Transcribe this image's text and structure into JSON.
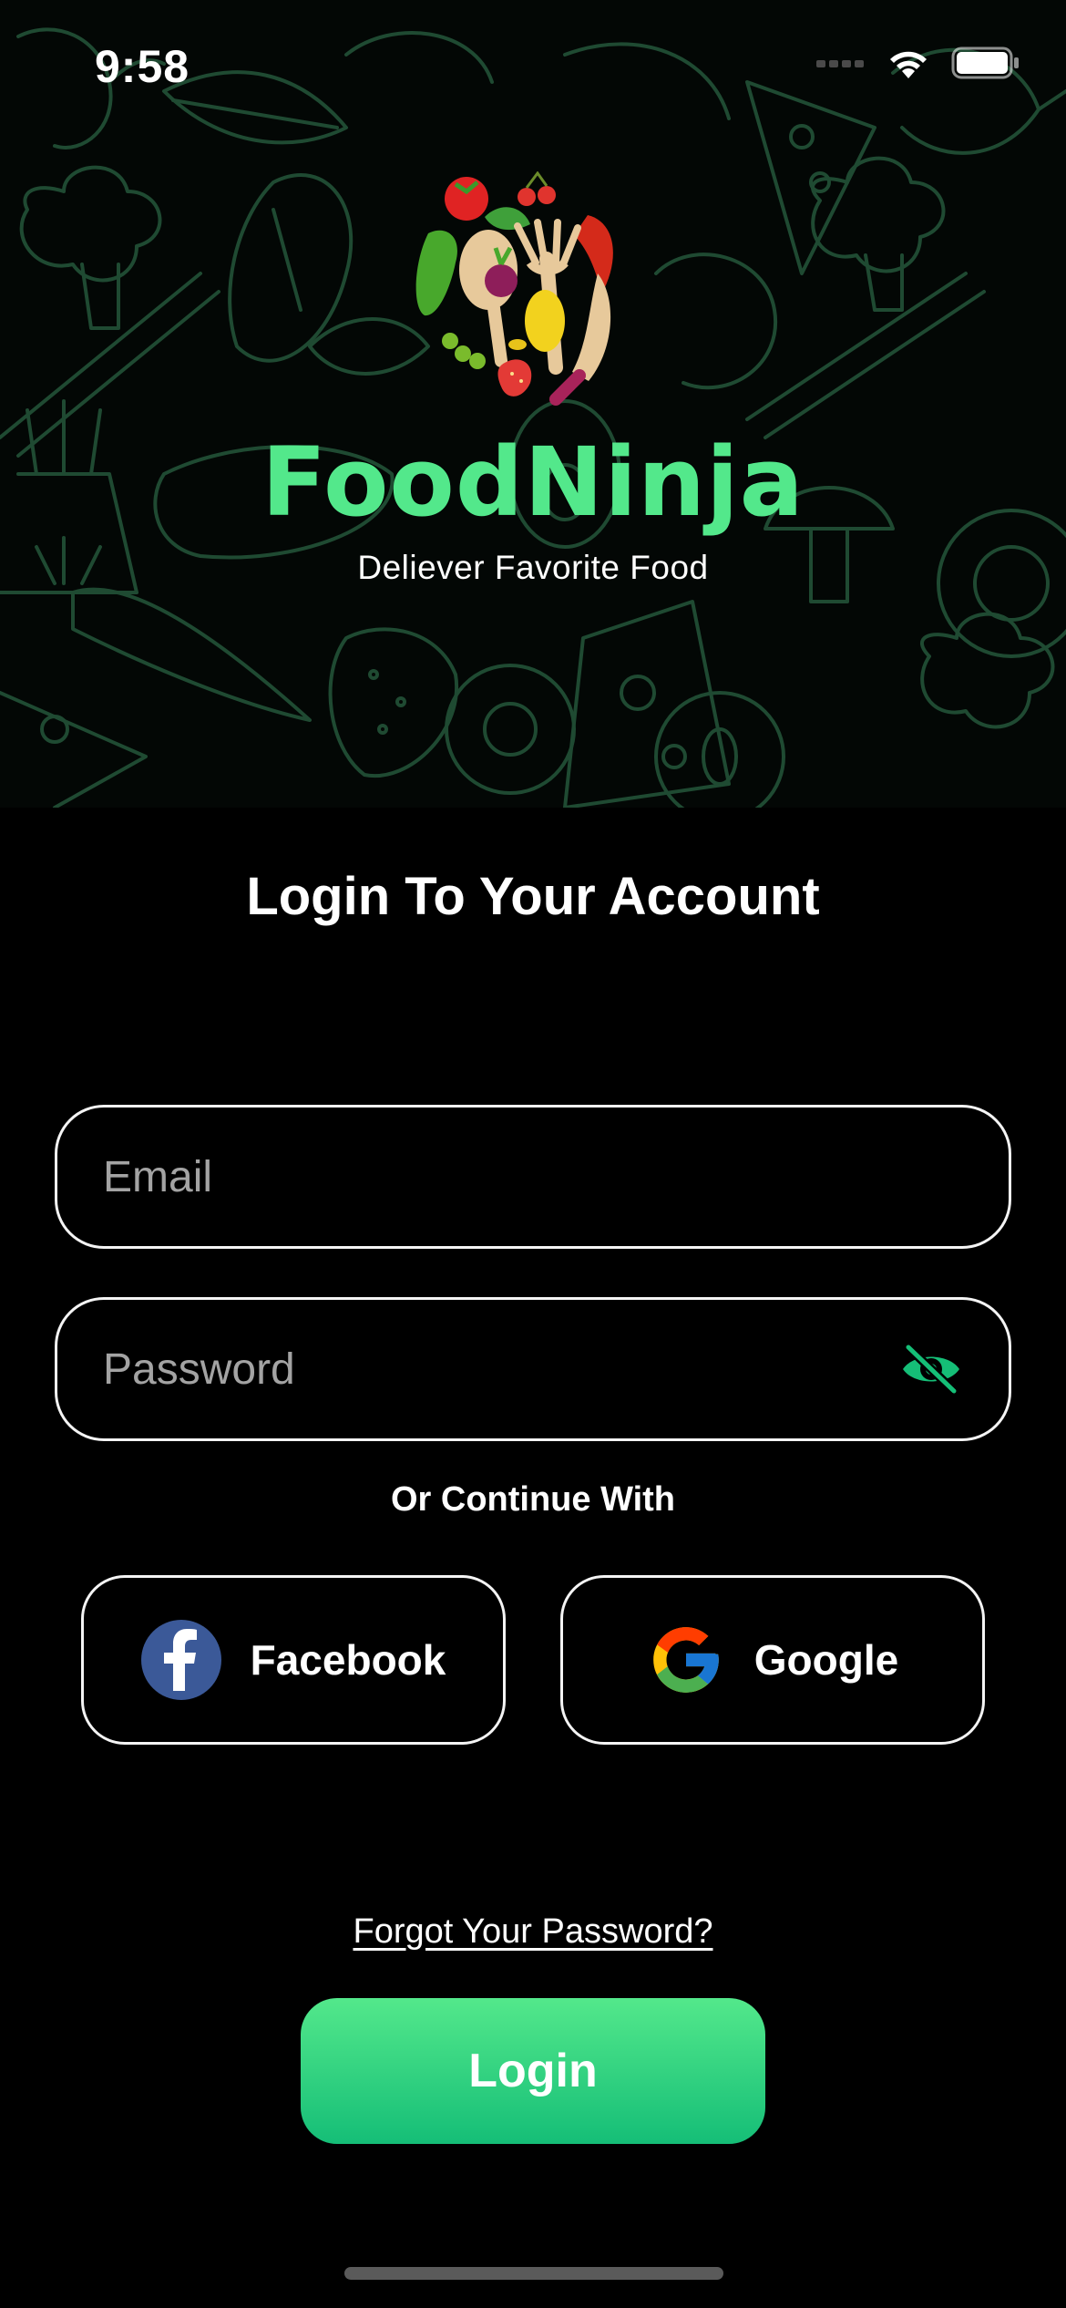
{
  "status_bar": {
    "time": "9:58",
    "icons": [
      "signal-icon",
      "wifi-icon",
      "battery-icon"
    ]
  },
  "hero": {
    "brand": "FoodNinja",
    "tagline": "Deliever Favorite Food",
    "colors": {
      "brand": "#53E88B",
      "pattern": "#1F4A32"
    }
  },
  "login": {
    "title": "Login To Your Account",
    "email": {
      "placeholder": "Email",
      "value": ""
    },
    "password": {
      "placeholder": "Password",
      "value": "",
      "toggle_icon": "eye-off-icon"
    },
    "or_text": "Or Continue With",
    "social": [
      {
        "label": "Facebook",
        "icon": "facebook-icon",
        "color": "#3B5998"
      },
      {
        "label": "Google",
        "icon": "google-icon"
      }
    ],
    "forgot": "Forgot Your Password?",
    "submit": "Login",
    "colors": {
      "accent_top": "#53E88B",
      "accent_bottom": "#15BE77"
    }
  }
}
